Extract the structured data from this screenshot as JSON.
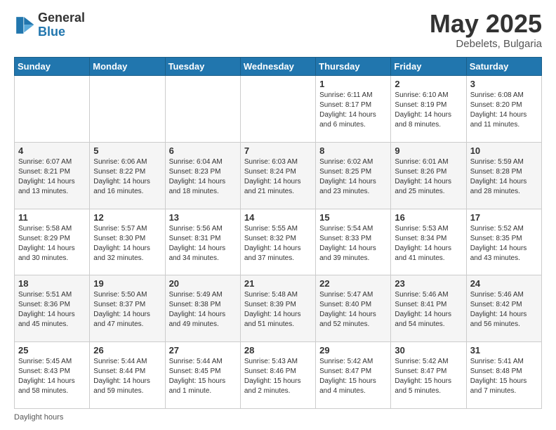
{
  "header": {
    "logo_general": "General",
    "logo_blue": "Blue",
    "month_year": "May 2025",
    "location": "Debelets, Bulgaria"
  },
  "weekdays": [
    "Sunday",
    "Monday",
    "Tuesday",
    "Wednesday",
    "Thursday",
    "Friday",
    "Saturday"
  ],
  "legend": {
    "daylight_label": "Daylight hours"
  },
  "weeks": [
    [
      {
        "day": "",
        "info": ""
      },
      {
        "day": "",
        "info": ""
      },
      {
        "day": "",
        "info": ""
      },
      {
        "day": "",
        "info": ""
      },
      {
        "day": "1",
        "info": "Sunrise: 6:11 AM\nSunset: 8:17 PM\nDaylight: 14 hours\nand 6 minutes."
      },
      {
        "day": "2",
        "info": "Sunrise: 6:10 AM\nSunset: 8:19 PM\nDaylight: 14 hours\nand 8 minutes."
      },
      {
        "day": "3",
        "info": "Sunrise: 6:08 AM\nSunset: 8:20 PM\nDaylight: 14 hours\nand 11 minutes."
      }
    ],
    [
      {
        "day": "4",
        "info": "Sunrise: 6:07 AM\nSunset: 8:21 PM\nDaylight: 14 hours\nand 13 minutes."
      },
      {
        "day": "5",
        "info": "Sunrise: 6:06 AM\nSunset: 8:22 PM\nDaylight: 14 hours\nand 16 minutes."
      },
      {
        "day": "6",
        "info": "Sunrise: 6:04 AM\nSunset: 8:23 PM\nDaylight: 14 hours\nand 18 minutes."
      },
      {
        "day": "7",
        "info": "Sunrise: 6:03 AM\nSunset: 8:24 PM\nDaylight: 14 hours\nand 21 minutes."
      },
      {
        "day": "8",
        "info": "Sunrise: 6:02 AM\nSunset: 8:25 PM\nDaylight: 14 hours\nand 23 minutes."
      },
      {
        "day": "9",
        "info": "Sunrise: 6:01 AM\nSunset: 8:26 PM\nDaylight: 14 hours\nand 25 minutes."
      },
      {
        "day": "10",
        "info": "Sunrise: 5:59 AM\nSunset: 8:28 PM\nDaylight: 14 hours\nand 28 minutes."
      }
    ],
    [
      {
        "day": "11",
        "info": "Sunrise: 5:58 AM\nSunset: 8:29 PM\nDaylight: 14 hours\nand 30 minutes."
      },
      {
        "day": "12",
        "info": "Sunrise: 5:57 AM\nSunset: 8:30 PM\nDaylight: 14 hours\nand 32 minutes."
      },
      {
        "day": "13",
        "info": "Sunrise: 5:56 AM\nSunset: 8:31 PM\nDaylight: 14 hours\nand 34 minutes."
      },
      {
        "day": "14",
        "info": "Sunrise: 5:55 AM\nSunset: 8:32 PM\nDaylight: 14 hours\nand 37 minutes."
      },
      {
        "day": "15",
        "info": "Sunrise: 5:54 AM\nSunset: 8:33 PM\nDaylight: 14 hours\nand 39 minutes."
      },
      {
        "day": "16",
        "info": "Sunrise: 5:53 AM\nSunset: 8:34 PM\nDaylight: 14 hours\nand 41 minutes."
      },
      {
        "day": "17",
        "info": "Sunrise: 5:52 AM\nSunset: 8:35 PM\nDaylight: 14 hours\nand 43 minutes."
      }
    ],
    [
      {
        "day": "18",
        "info": "Sunrise: 5:51 AM\nSunset: 8:36 PM\nDaylight: 14 hours\nand 45 minutes."
      },
      {
        "day": "19",
        "info": "Sunrise: 5:50 AM\nSunset: 8:37 PM\nDaylight: 14 hours\nand 47 minutes."
      },
      {
        "day": "20",
        "info": "Sunrise: 5:49 AM\nSunset: 8:38 PM\nDaylight: 14 hours\nand 49 minutes."
      },
      {
        "day": "21",
        "info": "Sunrise: 5:48 AM\nSunset: 8:39 PM\nDaylight: 14 hours\nand 51 minutes."
      },
      {
        "day": "22",
        "info": "Sunrise: 5:47 AM\nSunset: 8:40 PM\nDaylight: 14 hours\nand 52 minutes."
      },
      {
        "day": "23",
        "info": "Sunrise: 5:46 AM\nSunset: 8:41 PM\nDaylight: 14 hours\nand 54 minutes."
      },
      {
        "day": "24",
        "info": "Sunrise: 5:46 AM\nSunset: 8:42 PM\nDaylight: 14 hours\nand 56 minutes."
      }
    ],
    [
      {
        "day": "25",
        "info": "Sunrise: 5:45 AM\nSunset: 8:43 PM\nDaylight: 14 hours\nand 58 minutes."
      },
      {
        "day": "26",
        "info": "Sunrise: 5:44 AM\nSunset: 8:44 PM\nDaylight: 14 hours\nand 59 minutes."
      },
      {
        "day": "27",
        "info": "Sunrise: 5:44 AM\nSunset: 8:45 PM\nDaylight: 15 hours\nand 1 minute."
      },
      {
        "day": "28",
        "info": "Sunrise: 5:43 AM\nSunset: 8:46 PM\nDaylight: 15 hours\nand 2 minutes."
      },
      {
        "day": "29",
        "info": "Sunrise: 5:42 AM\nSunset: 8:47 PM\nDaylight: 15 hours\nand 4 minutes."
      },
      {
        "day": "30",
        "info": "Sunrise: 5:42 AM\nSunset: 8:47 PM\nDaylight: 15 hours\nand 5 minutes."
      },
      {
        "day": "31",
        "info": "Sunrise: 5:41 AM\nSunset: 8:48 PM\nDaylight: 15 hours\nand 7 minutes."
      }
    ]
  ]
}
